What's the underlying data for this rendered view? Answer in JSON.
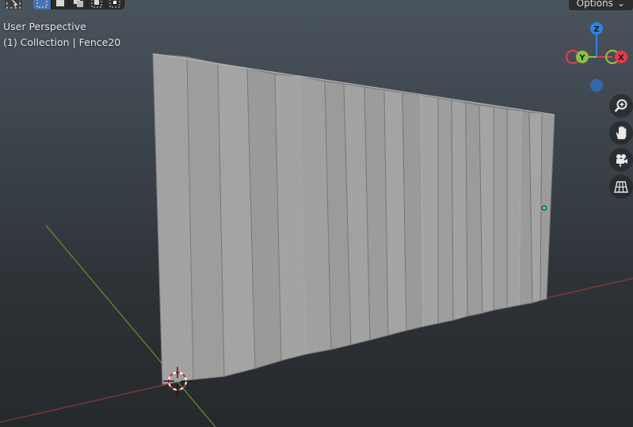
{
  "viewport": {
    "view_name": "User Perspective",
    "collection_info": "(1) Collection | Fence20"
  },
  "header": {
    "options_label": "Options",
    "select_modes": [
      "select-box",
      "mode-new",
      "mode-extend",
      "mode-subtract",
      "mode-intersect"
    ],
    "active_mode": "select-box"
  },
  "gizmo": {
    "axes": [
      {
        "label": "Z",
        "color": "#2f83e0"
      },
      {
        "label": "Y",
        "color": "#8ac23c"
      },
      {
        "label": "X",
        "color": "#e8394f"
      }
    ]
  },
  "nav_buttons": [
    {
      "name": "zoom-icon"
    },
    {
      "name": "pan-hand-icon"
    },
    {
      "name": "camera-icon"
    },
    {
      "name": "ortho-grid-icon"
    }
  ],
  "colors": {
    "x_axis_line": "#a33a3a",
    "y_axis_line": "#5e9a2e",
    "fence": "#9c9c9c",
    "origin_dot": "#2fe0b0"
  }
}
